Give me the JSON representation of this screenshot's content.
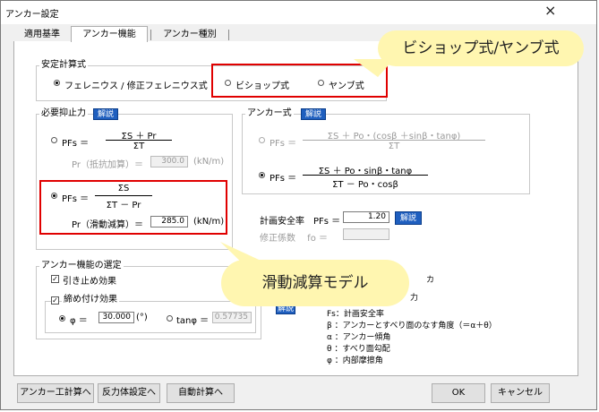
{
  "window": {
    "title": "アンカー設定",
    "close_glyph": "×"
  },
  "tabs": [
    {
      "label": "適用基準"
    },
    {
      "label": "アンカー機能"
    },
    {
      "label": "アンカー種別"
    }
  ],
  "stability": {
    "legend": "安定計算式",
    "options": [
      {
        "label": "フェレニウス / 修正フェレニウス式",
        "selected": true
      },
      {
        "label": "ビショップ式",
        "selected": false
      },
      {
        "label": "ヤンブ式",
        "selected": false
      }
    ]
  },
  "required_force": {
    "legend": "必要抑止力",
    "help": "解説",
    "formula1": {
      "lhs": "PFs ＝",
      "num": "ΣS ＋ Pr",
      "den": "ΣT"
    },
    "pr1": {
      "label": "Pr（抵抗加算）＝",
      "value": "300.0",
      "unit": "(kN/m)"
    },
    "formula2": {
      "lhs": "PFs ＝",
      "num": "ΣS",
      "den": "ΣT － Pr"
    },
    "pr2": {
      "label": "Pr（滑動減算）＝",
      "value": "285.0",
      "unit": "(kN/m)"
    }
  },
  "anchor_formula": {
    "legend": "アンカー式",
    "help": "解説",
    "f1": {
      "lhs": "PFs ＝",
      "num": "ΣS ＋ Po・(cosβ ＋sinβ・tanφ)",
      "den": "ΣT"
    },
    "f2": {
      "lhs": "PFs ＝",
      "num": "ΣS ＋ Po・sinβ・tanφ",
      "den": "ΣT － Po・cosβ"
    }
  },
  "safety": {
    "label": "計画安全率　PFs ＝",
    "value": "1.20",
    "help": "解説",
    "corr_label": "修正係数　 fo ＝",
    "corr_value": ""
  },
  "function": {
    "legend": "アンカー機能の選定",
    "prevent": {
      "label": "引き止め効果",
      "checked": true
    },
    "tighten": {
      "label": "締め付け効果",
      "checked": true
    },
    "phi": {
      "label": "φ ＝",
      "value": "30.000",
      "unit": "(°)"
    },
    "tanphi": {
      "label": "tanφ ＝",
      "value": "0.57735"
    },
    "help": "解説"
  },
  "legend_notes": [
    {
      "text": "Fs：計画安全率"
    },
    {
      "text": "β ：アンカーとすべり面のなす角度（＝α＋θ）"
    },
    {
      "text": "α ：アンカー傾角"
    },
    {
      "text": "θ ：すべり面勾配"
    },
    {
      "text": "φ ：内部摩擦角"
    }
  ],
  "partial_text": {
    "a": "カ",
    "b": "力"
  },
  "buttons": {
    "calc": "アンカー工計算へ",
    "reaction": "反力体設定へ",
    "auto": "自動計算へ",
    "ok": "OK",
    "cancel": "キャンセル"
  },
  "callouts": {
    "top": "ビショップ式/ヤンブ式",
    "bottom": "滑動減算モデル"
  },
  "colors": {
    "highlight": "#e00000",
    "callout": "#fff6b0",
    "help_button": "#1f5fbf"
  }
}
